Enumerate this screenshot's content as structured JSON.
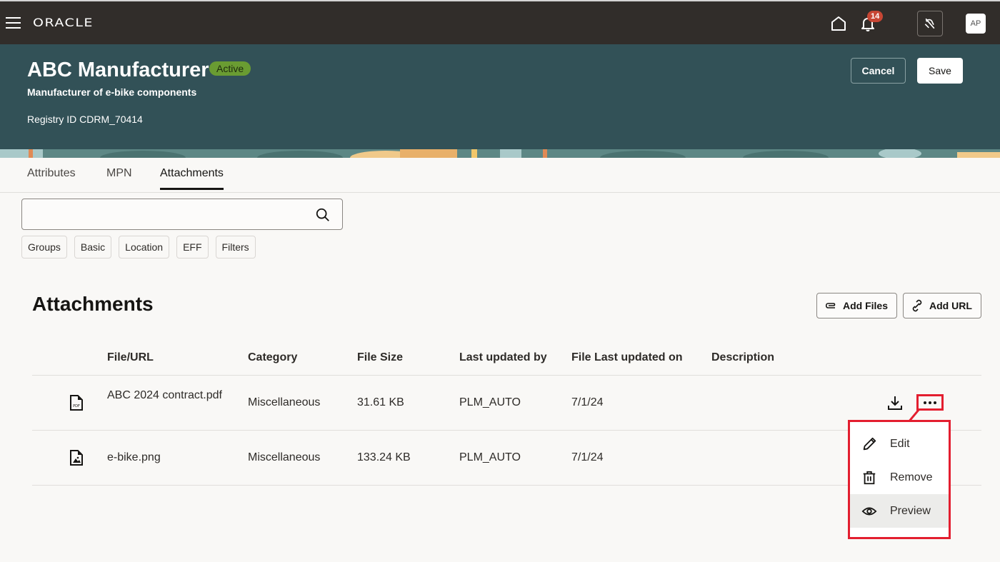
{
  "topbar": {
    "logo": "ORACLE",
    "notification_count": "14",
    "avatar_initials": "AP"
  },
  "header": {
    "title": "ABC Manufacturer",
    "status": "Active",
    "subtitle": "Manufacturer of e-bike components",
    "registry": "Registry ID CDRM_70414",
    "cancel_label": "Cancel",
    "save_label": "Save"
  },
  "tabs": [
    {
      "label": "Attributes",
      "active": false
    },
    {
      "label": "MPN",
      "active": false
    },
    {
      "label": "Attachments",
      "active": true
    }
  ],
  "search": {
    "value": "",
    "placeholder": ""
  },
  "chips": [
    "Groups",
    "Basic",
    "Location",
    "EFF",
    "Filters"
  ],
  "attachments": {
    "title": "Attachments",
    "add_files_label": "Add Files",
    "add_url_label": "Add URL",
    "columns": [
      "File/URL",
      "Category",
      "File Size",
      "Last updated by",
      "File Last updated on",
      "Description"
    ],
    "rows": [
      {
        "icon": "pdf-file-icon",
        "file": "ABC 2024 contract.pdf",
        "category": "Miscellaneous",
        "size": "31.61 KB",
        "updated_by": "PLM_AUTO",
        "updated_on": "7/1/24",
        "description": ""
      },
      {
        "icon": "image-file-icon",
        "file": "e-bike.png",
        "category": "Miscellaneous",
        "size": "133.24 KB",
        "updated_by": "PLM_AUTO",
        "updated_on": "7/1/24",
        "description": ""
      }
    ]
  },
  "action_menu": {
    "items": [
      {
        "label": "Edit",
        "icon": "pencil-icon"
      },
      {
        "label": "Remove",
        "icon": "trash-icon"
      },
      {
        "label": "Preview",
        "icon": "eye-icon",
        "highlighted": true
      }
    ]
  },
  "colors": {
    "header_bg": "#325157",
    "topbar_bg": "#312d2a",
    "status_green": "#6a9c32",
    "badge_red": "#c74634",
    "annotation_red": "#e31e2f"
  }
}
